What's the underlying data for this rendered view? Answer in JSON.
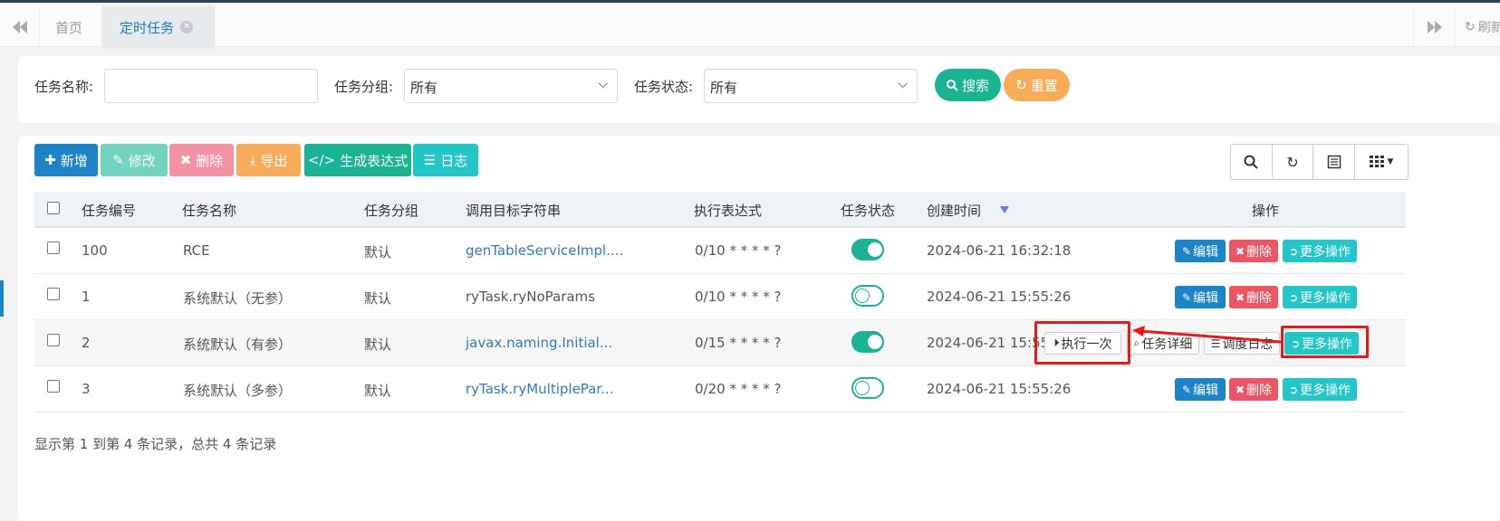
{
  "tabs": {
    "home": "首页",
    "active": "定时任务",
    "refresh": "刷新"
  },
  "search": {
    "name_label": "任务名称:",
    "group_label": "任务分组:",
    "group_value": "所有",
    "status_label": "任务状态:",
    "status_value": "所有",
    "search_btn": "搜索",
    "reset_btn": "重置"
  },
  "toolbar": {
    "add": "新增",
    "edit": "修改",
    "delete": "删除",
    "export": "导出",
    "cron": "生成表达式",
    "log": "日志"
  },
  "table": {
    "headers": [
      "任务编号",
      "任务名称",
      "任务分组",
      "调用目标字符串",
      "执行表达式",
      "任务状态",
      "创建时间",
      "操作"
    ],
    "rows": [
      {
        "id": "100",
        "name": "RCE",
        "group": "默认",
        "target": "genTableServiceImpl....",
        "cron": "0/10 * * * * ?",
        "status_on": true,
        "created": "2024-06-21 16:32:18"
      },
      {
        "id": "1",
        "name": "系统默认（无参）",
        "group": "默认",
        "target": "ryTask.ryNoParams",
        "cron": "0/10 * * * * ?",
        "status_on": false,
        "created": "2024-06-21 15:55:26"
      },
      {
        "id": "2",
        "name": "系统默认（有参）",
        "group": "默认",
        "target": "javax.naming.Initial...",
        "cron": "0/15 * * * * ?",
        "status_on": true,
        "created": "2024-06-21 15:55"
      },
      {
        "id": "3",
        "name": "系统默认（多参）",
        "group": "默认",
        "target": "ryTask.ryMultiplePar...",
        "cron": "0/20 * * * * ?",
        "status_on": false,
        "created": "2024-06-21 15:55:26"
      }
    ],
    "actions": {
      "edit": "编辑",
      "delete": "删除",
      "more": "更多操作",
      "run_once": "执行一次",
      "detail": "任务详细",
      "schedule_log": "调度日志"
    }
  },
  "footer": {
    "info": "显示第 1 到第 4 条记录，总共 4 条记录"
  },
  "colors": {
    "primary": "#1c84c6",
    "success": "#1ab394",
    "info": "#23c6c8",
    "warning": "#f8ac59",
    "danger": "#ed5565",
    "annotation": "#e8191b"
  }
}
